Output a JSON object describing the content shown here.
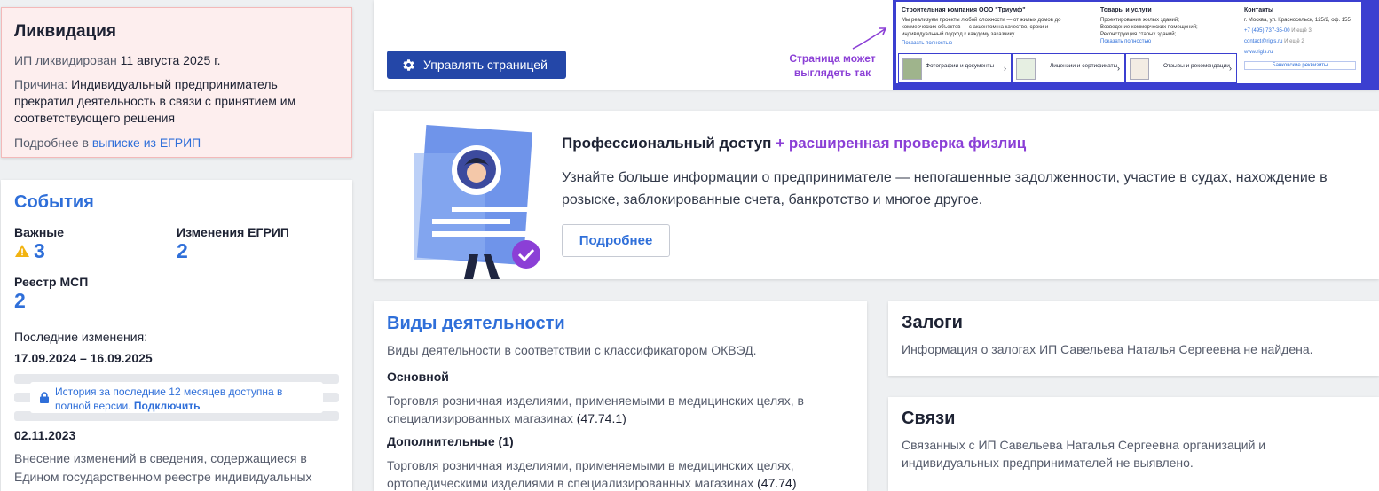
{
  "liquidation": {
    "title": "Ликвидация",
    "status_prefix": "ИП ликвидирован",
    "status_date": "11 августа 2025 г.",
    "reason_prefix": "Причина:",
    "reason_text": "Индивидуальный предприниматель прекратил деятельность в связи с принятием им соответствующего решения",
    "more_prefix": "Подробнее в",
    "more_link": "выписке из ЕГРИП"
  },
  "events": {
    "title": "События",
    "important_label": "Важные",
    "important_value": "3",
    "egrip_label": "Изменения ЕГРИП",
    "egrip_value": "2",
    "msp_label": "Реестр МСП",
    "msp_value": "2",
    "last_changes_label": "Последние изменения:",
    "range": "17.09.2024 – 16.09.2025",
    "history_text": "История за последние 12 месяцев доступна в полной версии.",
    "history_link": "Подключить",
    "entry_date": "02.11.2023",
    "entry_text": "Внесение изменений в сведения, содержащиеся в Едином государственном реестре индивидуальных"
  },
  "manage": {
    "button_label": "Управлять страницей",
    "note": "Страница может выглядеть так",
    "preview": {
      "company_title": "Строительная компания ООО \"Триумф\"",
      "company_desc": "Мы реализуем проекты любой сложности — от жилых домов до коммерческих объектов — с акцентом на качество, сроки и индивидуальный подход к каждому заказчику.",
      "company_more": "Показать полностью",
      "goods_title": "Товары и услуги",
      "goods": [
        "Проектирование жилых зданий;",
        "Возведение коммерческих помещений;",
        "Реконструкция старых зданий;"
      ],
      "goods_more": "Показать полностью",
      "contacts_title": "Контакты",
      "address": "г. Москва, ул. Красносельск, 125/2, оф. 155",
      "phone": "+7 (495) 737-35-00",
      "phone_more": "И ещё 3",
      "email": "contact@rigls.ru",
      "email_more": "И ещё 2",
      "site": "www.rigls.ru",
      "bank": "Банковские реквизиты",
      "tiles": [
        "Фотографии и документы",
        "Лицензии и сертификаты",
        "Отзывы и рекомендации"
      ]
    }
  },
  "pro": {
    "title_main": "Профессиональный доступ",
    "title_accent": "+ расширенная проверка физлиц",
    "text": "Узнайте больше информации о предпринимателе — непогашенные задолженности, участие в судах, нахождение в розыске, заблокированные счета, банкротство и многое другое.",
    "button_label": "Подробнее"
  },
  "activities": {
    "title": "Виды деятельности",
    "subtitle": "Виды деятельности в соответствии с классификатором ОКВЭД.",
    "main_heading": "Основной",
    "main_text": "Торговля розничная изделиями, применяемыми в медицинских целях, в специализированных магазинах",
    "main_code": "(47.74.1)",
    "extra_heading": "Дополнительные (1)",
    "extra_text": "Торговля розничная изделиями, применяемыми в медицинских целях, ортопедическими изделиями в специализированных магазинах",
    "extra_code": "(47.74)"
  },
  "pledges": {
    "title": "Залоги",
    "text": "Информация о залогах ИП Савельева Наталья Сергеевна не найдена."
  },
  "links": {
    "title": "Связи",
    "text": "Связанных с ИП Савельева Наталья Сергеевна организаций и индивидуальных предпринимателей не выявлено."
  },
  "colors": {
    "accent": "#2f6fd9",
    "purple": "#8b3fd6",
    "danger_bg": "#fdeeee",
    "button_dark": "#2447a8"
  }
}
